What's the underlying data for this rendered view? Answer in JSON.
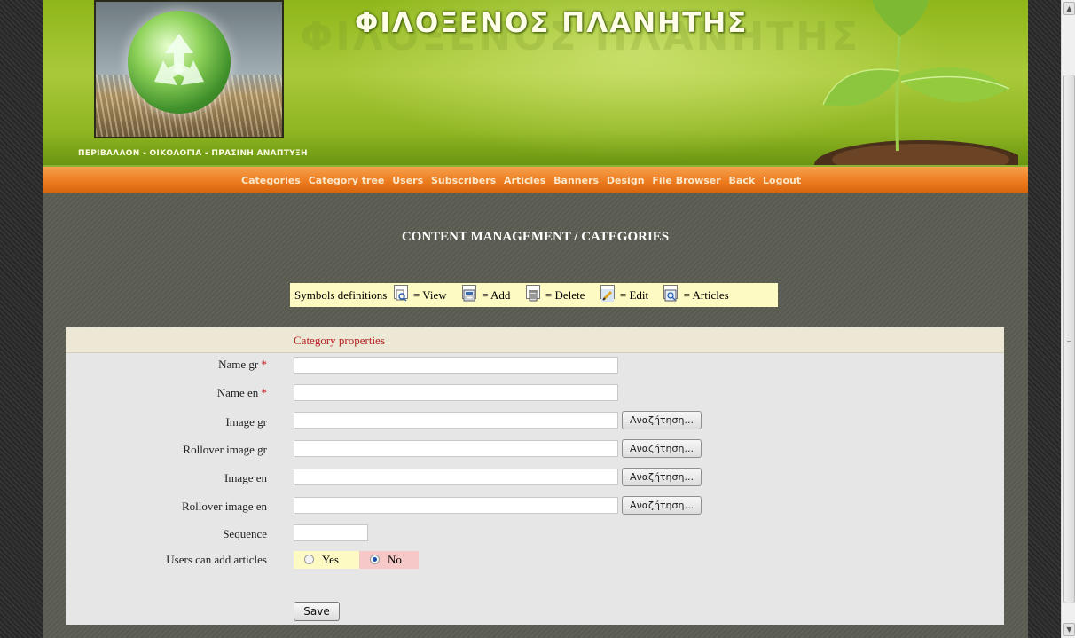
{
  "header": {
    "site_title": "ΦΙΛΟΞΕΝΟΣ ΠΛΑΝΗΤΗΣ",
    "tagline": "ΠΕΡΙΒΑΛΛΟΝ - ΟΙΚΟΛΟΓΙΑ - ΠΡΑΣΙΝΗ ΑΝΑΠΤΥΞΗ",
    "logo_icon": "recycle-icon"
  },
  "nav": {
    "items": [
      "Categories",
      "Category tree",
      "Users",
      "Subscribers",
      "Articles",
      "Banners",
      "Design",
      "File Browser",
      "Back",
      "Logout"
    ]
  },
  "page": {
    "heading": "CONTENT MANAGEMENT / CATEGORIES"
  },
  "legend": {
    "label": "Symbols definitions",
    "symbols": [
      {
        "icon": "view-icon",
        "text": "= View"
      },
      {
        "icon": "add-icon",
        "text": "= Add"
      },
      {
        "icon": "delete-icon",
        "text": "= Delete"
      },
      {
        "icon": "edit-icon",
        "text": "= Edit"
      },
      {
        "icon": "articles-icon",
        "text": "= Articles"
      }
    ]
  },
  "form": {
    "title": "Category properties",
    "required_mark": "*",
    "fields": [
      {
        "label": "Name gr",
        "required": true,
        "value": ""
      },
      {
        "label": "Name en",
        "required": true,
        "value": ""
      },
      {
        "label": "Image gr",
        "value": "",
        "browse": "Αναζήτηση..."
      },
      {
        "label": "Rollover image gr",
        "value": "",
        "browse": "Αναζήτηση..."
      },
      {
        "label": "Image en",
        "value": "",
        "browse": "Αναζήτηση..."
      },
      {
        "label": "Rollover image en",
        "value": "",
        "browse": "Αναζήτηση..."
      },
      {
        "label": "Sequence",
        "value": ""
      }
    ],
    "users_add": {
      "label": "Users can add articles",
      "yes": "Yes",
      "no": "No",
      "selected": "No"
    },
    "save_label": "Save"
  },
  "colors": {
    "nav_orange": "#ec7a1e",
    "header_green": "#a9c93a",
    "legend_bg": "#fdfac4",
    "title_red": "#b52020"
  }
}
